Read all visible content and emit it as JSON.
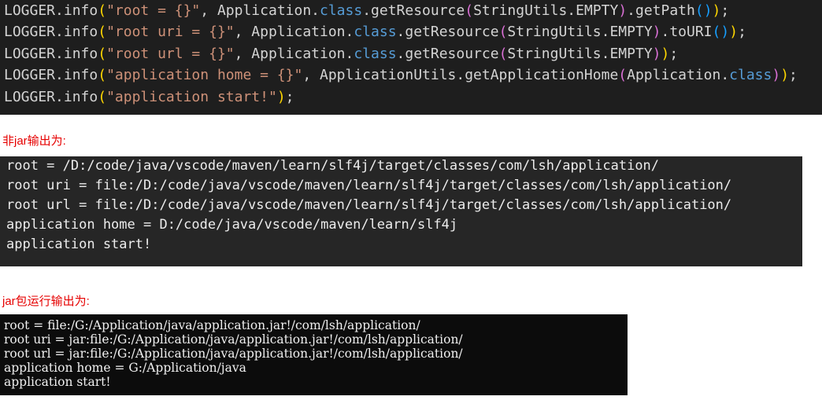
{
  "code": {
    "lines": [
      [
        {
          "t": "LOGGER.info",
          "c": "plain"
        },
        {
          "t": "(",
          "c": "bracket-1"
        },
        {
          "t": "\"root = {}\"",
          "c": "string"
        },
        {
          "t": ", Application.",
          "c": "plain"
        },
        {
          "t": "class",
          "c": "keyword"
        },
        {
          "t": ".getResource",
          "c": "plain"
        },
        {
          "t": "(",
          "c": "bracket-2"
        },
        {
          "t": "StringUtils.EMPTY",
          "c": "plain"
        },
        {
          "t": ")",
          "c": "bracket-2"
        },
        {
          "t": ".getPath",
          "c": "plain"
        },
        {
          "t": "()",
          "c": "bracket-3"
        },
        {
          "t": ")",
          "c": "bracket-1"
        },
        {
          "t": ";",
          "c": "plain"
        }
      ],
      [
        {
          "t": "LOGGER.info",
          "c": "plain"
        },
        {
          "t": "(",
          "c": "bracket-1"
        },
        {
          "t": "\"root uri = {}\"",
          "c": "string"
        },
        {
          "t": ", Application.",
          "c": "plain"
        },
        {
          "t": "class",
          "c": "keyword"
        },
        {
          "t": ".getResource",
          "c": "plain"
        },
        {
          "t": "(",
          "c": "bracket-2"
        },
        {
          "t": "StringUtils.EMPTY",
          "c": "plain"
        },
        {
          "t": ")",
          "c": "bracket-2"
        },
        {
          "t": ".toURI",
          "c": "plain"
        },
        {
          "t": "()",
          "c": "bracket-3"
        },
        {
          "t": ")",
          "c": "bracket-1"
        },
        {
          "t": ";",
          "c": "plain"
        }
      ],
      [
        {
          "t": "LOGGER.info",
          "c": "plain"
        },
        {
          "t": "(",
          "c": "bracket-1"
        },
        {
          "t": "\"root url = {}\"",
          "c": "string"
        },
        {
          "t": ", Application.",
          "c": "plain"
        },
        {
          "t": "class",
          "c": "keyword"
        },
        {
          "t": ".getResource",
          "c": "plain"
        },
        {
          "t": "(",
          "c": "bracket-2"
        },
        {
          "t": "StringUtils.EMPTY",
          "c": "plain"
        },
        {
          "t": ")",
          "c": "bracket-2"
        },
        {
          "t": ")",
          "c": "bracket-1"
        },
        {
          "t": ";",
          "c": "plain"
        }
      ],
      [
        {
          "t": "LOGGER.info",
          "c": "plain"
        },
        {
          "t": "(",
          "c": "bracket-1"
        },
        {
          "t": "\"application home = {}\"",
          "c": "string"
        },
        {
          "t": ", ApplicationUtils.getApplicationHome",
          "c": "plain"
        },
        {
          "t": "(",
          "c": "bracket-2"
        },
        {
          "t": "Application.",
          "c": "plain"
        },
        {
          "t": "class",
          "c": "keyword"
        },
        {
          "t": ")",
          "c": "bracket-2"
        },
        {
          "t": ")",
          "c": "bracket-1"
        },
        {
          "t": ";",
          "c": "plain"
        }
      ],
      [
        {
          "t": "LOGGER.info",
          "c": "plain"
        },
        {
          "t": "(",
          "c": "bracket-1"
        },
        {
          "t": "\"application start!\"",
          "c": "string"
        },
        {
          "t": ")",
          "c": "bracket-1"
        },
        {
          "t": ";",
          "c": "plain"
        }
      ]
    ]
  },
  "captions": {
    "non_jar": "非jar输出为:",
    "jar": "jar包运行输出为:"
  },
  "output_non_jar": {
    "lines": [
      "root = /D:/code/java/vscode/maven/learn/slf4j/target/classes/com/lsh/application/",
      "root uri = file:/D:/code/java/vscode/maven/learn/slf4j/target/classes/com/lsh/application/",
      "root url = file:/D:/code/java/vscode/maven/learn/slf4j/target/classes/com/lsh/application/",
      "application home = D:/code/java/vscode/maven/learn/slf4j",
      "application start!"
    ]
  },
  "output_jar": {
    "lines": [
      "root = file:/G:/Application/java/application.jar!/com/lsh/application/",
      "root uri = jar:file:/G:/Application/java/application.jar!/com/lsh/application/",
      "root url = jar:file:/G:/Application/java/application.jar!/com/lsh/application/",
      "application home = G:/Application/java",
      "application start!"
    ]
  },
  "colors": {
    "caption": "#e60000",
    "editor_background": "#1e1e1e",
    "string": "#ce9178",
    "keyword": "#569cd6",
    "bracket_level_1": "#ffd700",
    "bracket_level_2": "#da70d6",
    "bracket_level_3": "#179fff"
  }
}
